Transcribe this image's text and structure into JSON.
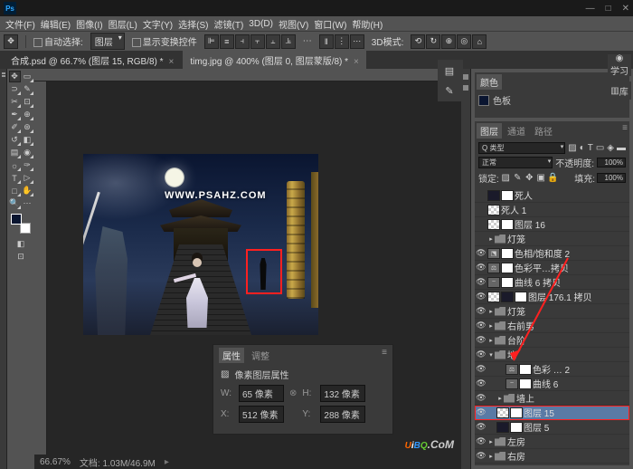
{
  "app_icon": "Ps",
  "menu": {
    "file": "文件(F)",
    "edit": "编辑(E)",
    "image": "图像(I)",
    "layer": "图层(L)",
    "type": "文字(Y)",
    "select": "选择(S)",
    "filter": "滤镜(T)",
    "3d": "3D(D)",
    "view": "视图(V)",
    "window": "窗口(W)",
    "help": "帮助(H)"
  },
  "options": {
    "auto_select": "自动选择:",
    "target": "图层",
    "show_transform": "显示变换控件",
    "mode_3d": "3D模式:"
  },
  "tabs": {
    "tab1": "合成.psd @ 66.7% (图层 15, RGB/8) *",
    "tab2": "timg.jpg @ 400% (图层 0, 图层蒙版/8) *"
  },
  "status": {
    "zoom": "66.67%",
    "doc": "文档: 1.03M/46.9M"
  },
  "watermark": "WWW.PSAHZ.COM",
  "small_panel": {
    "color_tab": "颜色",
    "swatch_tab": "色板"
  },
  "learn": "学习",
  "lib": "库",
  "layers": {
    "tab_layers": "图层",
    "tab_channels": "通道",
    "tab_paths": "路径",
    "type_filter": "Q 类型",
    "blend": "正常",
    "opacity_label": "不透明度:",
    "opacity": "100%",
    "lock_label": "锁定:",
    "fill_label": "填充:",
    "fill": "100%",
    "items": [
      {
        "eye": "",
        "name": "死人",
        "thumbs": [
          "dark",
          "mask"
        ]
      },
      {
        "eye": "",
        "name": "死人 1",
        "thumbs": [
          "checker"
        ]
      },
      {
        "eye": "",
        "name": "图层 16",
        "thumbs": [
          "checker",
          "mask"
        ]
      },
      {
        "eye": "",
        "name": "灯笼",
        "folder": true,
        "fold": "▸"
      },
      {
        "eye": "👁",
        "name": "色相/饱和度 2",
        "thumbs": [
          "adj",
          "mask"
        ],
        "adj": "⬔"
      },
      {
        "eye": "👁",
        "name": "色彩平…拷贝",
        "thumbs": [
          "adj",
          "mask"
        ],
        "adj": "⚖"
      },
      {
        "eye": "👁",
        "name": "曲线 6 拷贝",
        "thumbs": [
          "adj",
          "mask"
        ],
        "adj": "~"
      },
      {
        "eye": "👁",
        "name": "图层 176.1 拷贝",
        "thumbs": [
          "checker",
          "dark",
          "mask"
        ]
      },
      {
        "eye": "👁",
        "name": "灯笼",
        "folder": true,
        "fold": "▸"
      },
      {
        "eye": "👁",
        "name": "右前男",
        "folder": true,
        "fold": "▸"
      },
      {
        "eye": "👁",
        "name": "台阶",
        "folder": true,
        "fold": "▸"
      },
      {
        "eye": "👁",
        "name": "地",
        "folder": true,
        "fold": "▾",
        "open": true
      },
      {
        "eye": "👁",
        "name": "色彩 … 2",
        "thumbs": [
          "adj",
          "mask"
        ],
        "adj": "⚖",
        "indent": 2
      },
      {
        "eye": "👁",
        "name": "曲线 6",
        "thumbs": [
          "adj",
          "mask"
        ],
        "adj": "~",
        "indent": 2
      },
      {
        "eye": "👁",
        "name": "墙上",
        "folder": true,
        "fold": "▸",
        "indent": 1
      },
      {
        "eye": "👁",
        "name": "图层 15",
        "thumbs": [
          "checker",
          "mask"
        ],
        "indent": 1,
        "selected": true,
        "red": true
      },
      {
        "eye": "👁",
        "name": "图层 5",
        "thumbs": [
          "dark",
          "mask"
        ],
        "indent": 1
      },
      {
        "eye": "👁",
        "name": "左房",
        "folder": true,
        "fold": "▸"
      },
      {
        "eye": "👁",
        "name": "右房",
        "folder": true,
        "fold": "▸"
      }
    ]
  },
  "properties": {
    "tab1": "属性",
    "tab2": "调整",
    "title": "像素图层属性",
    "w_lbl": "W:",
    "w_val": "65 像素",
    "h_lbl": "H:",
    "h_val": "132 像素",
    "x_lbl": "X:",
    "x_val": "512 像素",
    "y_lbl": "Y:",
    "y_val": "288 像素"
  }
}
